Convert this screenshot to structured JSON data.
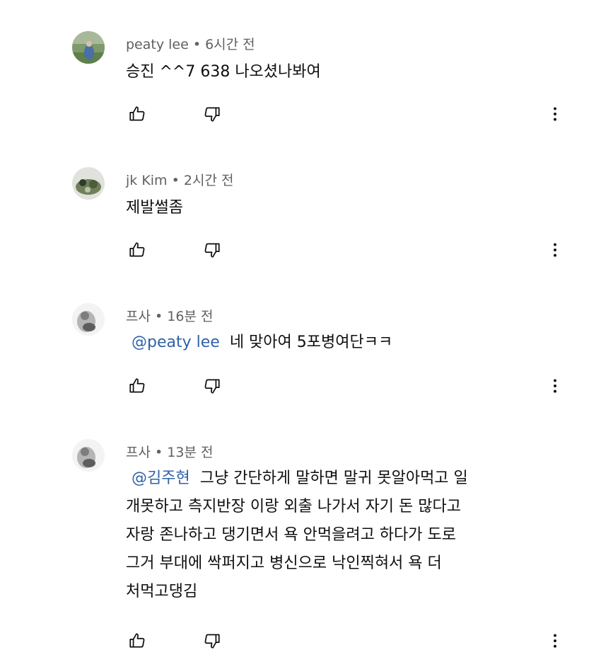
{
  "comments": [
    {
      "author": "peaty lee",
      "time": "6시간 전",
      "mention": "",
      "text": "승진 ^^7 638 나오셨나봐여",
      "lines": []
    },
    {
      "author": "jk Kim",
      "time": "2시간 전",
      "mention": "",
      "text": "제발썰좀",
      "lines": []
    },
    {
      "author": "프사",
      "time": "16분 전",
      "mention": "@peaty lee",
      "text": "네 맞아여 5포병여단ㅋㅋ",
      "lines": []
    },
    {
      "author": "프사",
      "time": "13분 전",
      "mention": "@김주현",
      "text": "그냥 간단하게 말하면 말귀 못알아먹고 일",
      "lines": [
        "개못하고 측지반장 이랑 외출 나가서 자기 돈 많다고",
        "자랑 존나하고 댕기면서 욕 안먹을려고 하다가 도로",
        "그거 부대에 싹퍼지고 병신으로 낙인찍혀서 욕 더",
        "처먹고댕김"
      ]
    }
  ],
  "separator": " • ",
  "icons": {
    "like": "thumbs-up-icon",
    "dislike": "thumbs-down-icon",
    "more": "more-vert-icon"
  }
}
